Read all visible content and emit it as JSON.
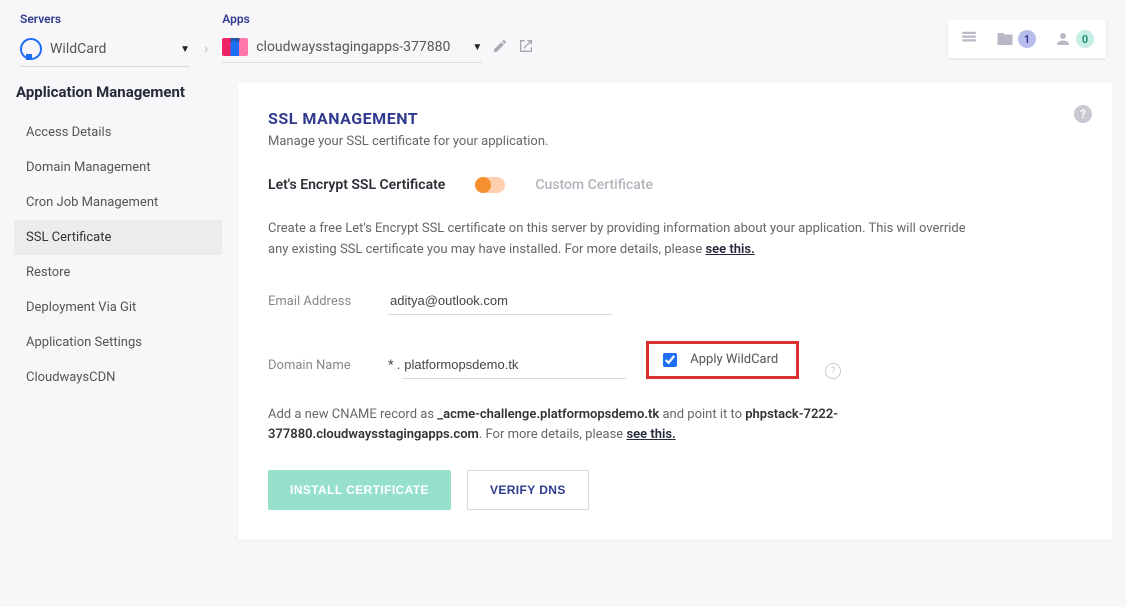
{
  "breadcrumb": {
    "servers_label": "Servers",
    "server_name": "WildCard",
    "apps_label": "Apps",
    "app_name": "cloudwaysstagingapps-377880"
  },
  "status": {
    "folder_count": "1",
    "user_count": "0"
  },
  "sidebar": {
    "title": "Application Management",
    "items": [
      {
        "label": "Access Details"
      },
      {
        "label": "Domain Management"
      },
      {
        "label": "Cron Job Management"
      },
      {
        "label": "SSL Certificate",
        "active": true
      },
      {
        "label": "Restore"
      },
      {
        "label": "Deployment Via Git"
      },
      {
        "label": "Application Settings"
      },
      {
        "label": "CloudwaysCDN"
      }
    ]
  },
  "card": {
    "title": "SSL MANAGEMENT",
    "subtitle": "Manage your SSL certificate for your application.",
    "tab_le": "Let's Encrypt SSL Certificate",
    "tab_custom": "Custom Certificate",
    "description_pre": "Create a free Let's Encrypt SSL certificate on this server by providing information about your application. This will override any existing SSL certificate you may have installed. For more details, please ",
    "see_this": "see this.",
    "email_label": "Email Address",
    "email_value": "aditya@outlook.com",
    "domain_label": "Domain Name",
    "domain_prefix": "* .",
    "domain_value": "platformopsdemo.tk",
    "wildcard_label": "Apply WildCard",
    "cname_pre": "Add a new CNAME record as ",
    "cname_host": "_acme-challenge.platformopsdemo.tk",
    "cname_mid": " and point it to ",
    "cname_target": "phpstack-7222-377880.cloudwaysstagingapps.com",
    "cname_post": ". For more details, please ",
    "btn_install": "INSTALL CERTIFICATE",
    "btn_verify": "VERIFY DNS"
  }
}
